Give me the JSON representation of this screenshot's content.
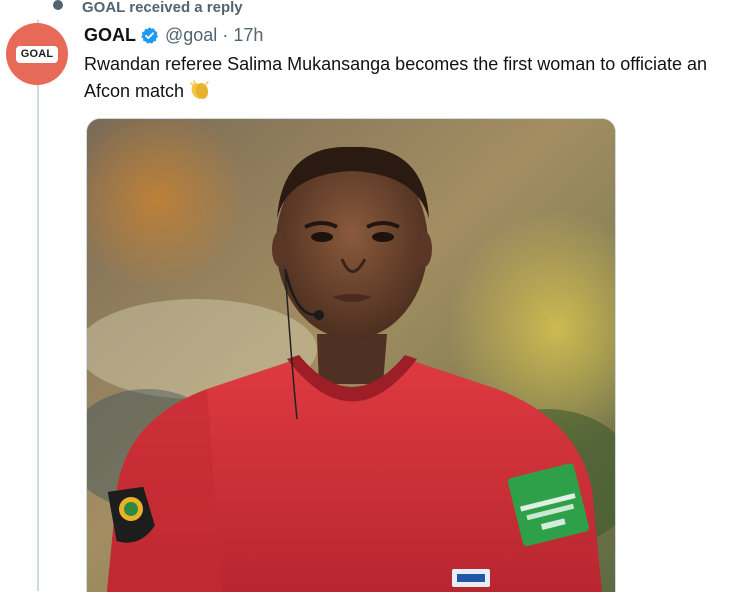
{
  "context": {
    "text": "GOAL received a reply",
    "icon": "pin-icon"
  },
  "tweet": {
    "avatar_label": "GOAL",
    "name": "GOAL",
    "handle": "@goal",
    "separator": "·",
    "time": "17h",
    "text": "Rwandan referee Salima Mukansanga becomes the first woman to officiate an Afcon match",
    "emoji": "clapping-hands-icon",
    "verified_icon": "verified-badge-icon"
  },
  "colors": {
    "avatar_bg": "#e66a57",
    "verified": "#1d9bf0",
    "shirt": "#d7333b",
    "muted_text": "#536471"
  }
}
